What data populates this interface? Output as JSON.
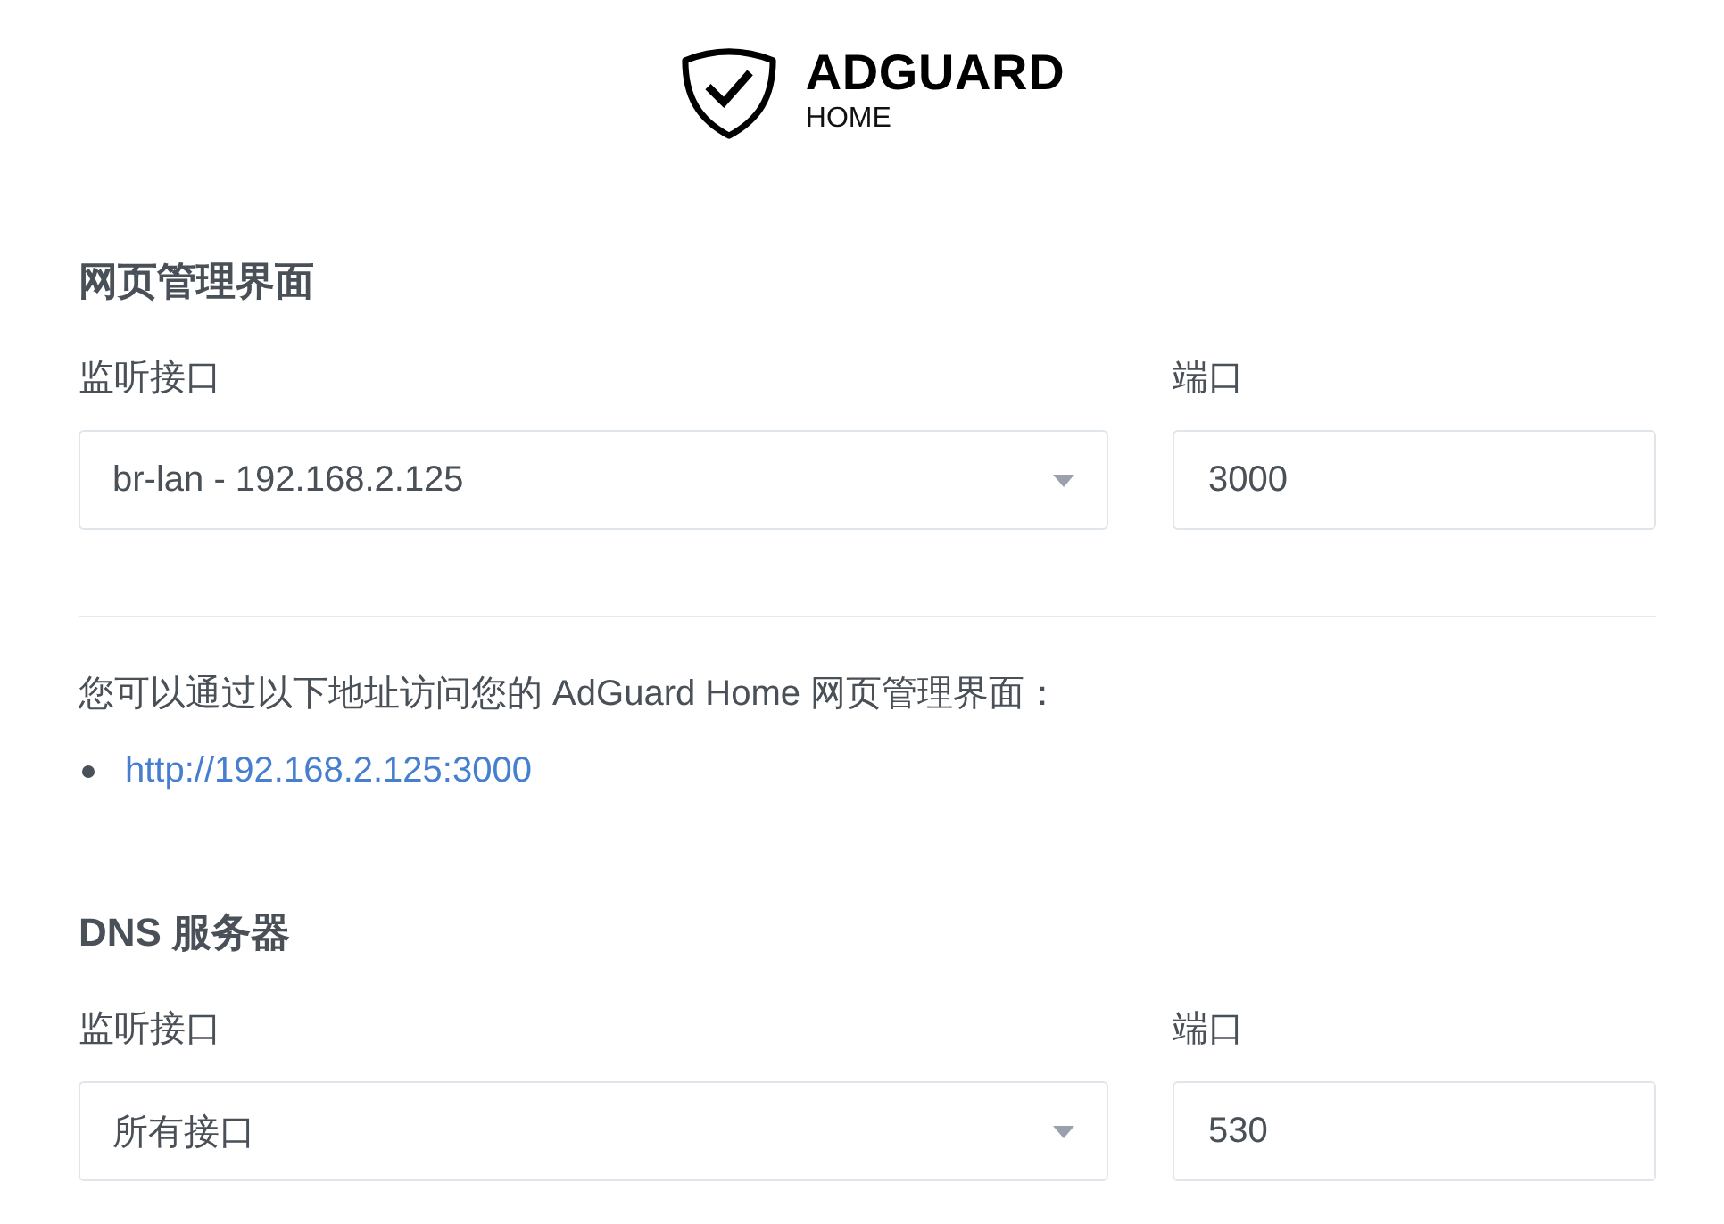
{
  "logo": {
    "name": "ADGUARD",
    "subtitle": "HOME"
  },
  "sections": [
    {
      "title": "网页管理界面",
      "interface": {
        "label": "监听接口",
        "value": "br-lan - 192.168.2.125"
      },
      "port": {
        "label": "端口",
        "value": "3000"
      },
      "note": {
        "text": "您可以通过以下地址访问您的 AdGuard Home 网页管理界面：",
        "links": [
          "http://192.168.2.125:3000"
        ]
      }
    },
    {
      "title": "DNS 服务器",
      "interface": {
        "label": "监听接口",
        "value": "所有接口"
      },
      "port": {
        "label": "端口",
        "value": "530"
      }
    }
  ]
}
